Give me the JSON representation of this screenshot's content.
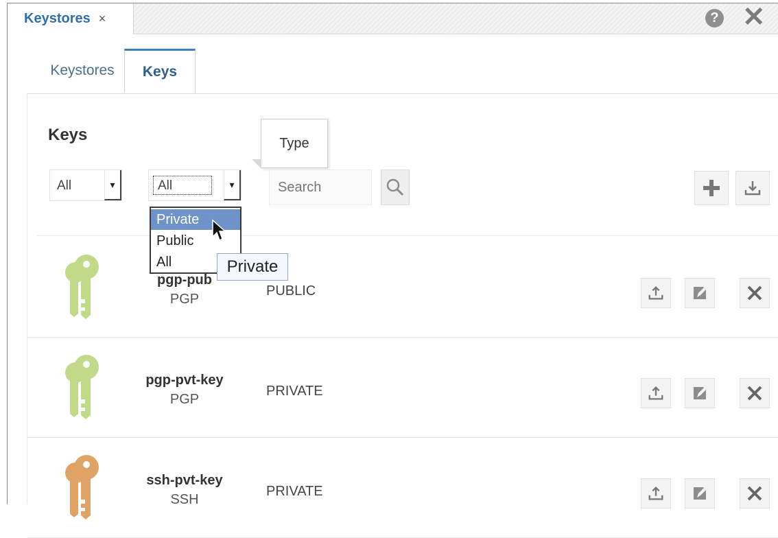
{
  "doc_tab": {
    "label": "Keystores",
    "close": "×"
  },
  "window_controls": {
    "help": "?",
    "close": "✕"
  },
  "subtabs": [
    {
      "label": "Keystores",
      "active": false
    },
    {
      "label": "Keys",
      "active": true
    }
  ],
  "section_title": "Keys",
  "filters": {
    "filter1_value": "All",
    "filter2_value": "All",
    "search_placeholder": "Search"
  },
  "tooltip_type": "Type",
  "dropdown": {
    "options": [
      "Private",
      "Public",
      "All"
    ],
    "highlighted": "Private"
  },
  "hover_tooltip": "Private",
  "toolbar": {
    "add_icon": "plus-icon",
    "download_icon": "download-icon"
  },
  "keys": [
    {
      "name": "pgp-pub",
      "type": "PGP",
      "visibility": "PUBLIC",
      "icon_color": "#c2d98a"
    },
    {
      "name": "pgp-pvt-key",
      "type": "PGP",
      "visibility": "PRIVATE",
      "icon_color": "#c2d98a"
    },
    {
      "name": "ssh-pvt-key",
      "type": "SSH",
      "visibility": "PRIVATE",
      "icon_color": "#e0a366"
    }
  ],
  "colors": {
    "accent": "#3a82c4",
    "highlight": "#6e93c9",
    "pgp_key": "#c2d98a",
    "ssh_key": "#e0a366"
  }
}
